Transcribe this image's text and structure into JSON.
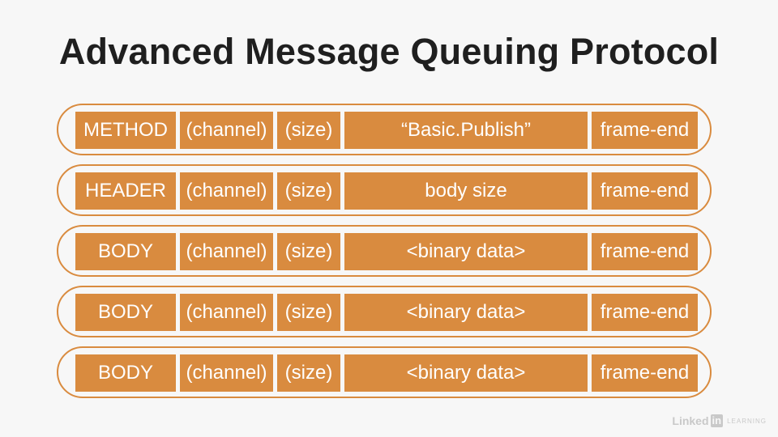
{
  "title": "Advanced Message Queuing Protocol",
  "frames": [
    {
      "type": "METHOD",
      "channel": "(channel)",
      "size": "(size)",
      "payload": "“Basic.Publish”",
      "end": "frame-end"
    },
    {
      "type": "HEADER",
      "channel": "(channel)",
      "size": "(size)",
      "payload": "body size",
      "end": "frame-end"
    },
    {
      "type": "BODY",
      "channel": "(channel)",
      "size": "(size)",
      "payload": "<binary data>",
      "end": "frame-end"
    },
    {
      "type": "BODY",
      "channel": "(channel)",
      "size": "(size)",
      "payload": "<binary data>",
      "end": "frame-end"
    },
    {
      "type": "BODY",
      "channel": "(channel)",
      "size": "(size)",
      "payload": "<binary data>",
      "end": "frame-end"
    }
  ],
  "watermark": {
    "brand": "Linked",
    "badge": "in",
    "suffix": "LEARNING"
  },
  "colors": {
    "accent": "#d98b3f",
    "background": "#f7f7f7",
    "title": "#1f1f1f"
  }
}
